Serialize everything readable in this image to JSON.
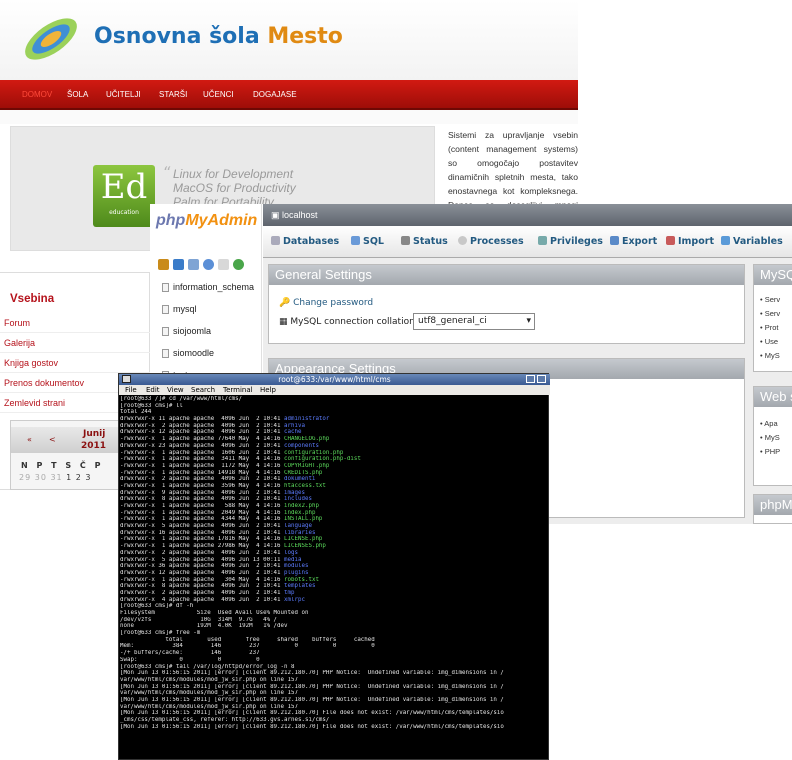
{
  "site": {
    "title_part1": "Osnovna šola",
    "title_part2": "Mesto",
    "nav": [
      "DOMOV",
      "ŠOLA",
      "UČITELJI",
      "STARŠI",
      "UČENCI",
      "DOGAJASE"
    ],
    "banner_logo_big": "Ed",
    "banner_logo_small": "education",
    "quote_mark": "“",
    "quote_lines": [
      "Linux for Development",
      "MacOS for Productivity",
      "Palm for Portability"
    ],
    "article": "Sistemi za upravljanje vsebin (content management systems) so omogočajo postavitev dinamičnih spletnih mesta, tako enostavnega kot kompleksnega. Danes so dosegljivi mnogi brezplačni sistemi, katerih cilji s",
    "sidebar_heading": "Vsebina",
    "sidebar_links": [
      "Forum",
      "Galerija",
      "Knjiga gostov",
      "Prenos dokumentov",
      "Zemlevid strani"
    ],
    "calendar": {
      "month": "Junij",
      "year": "2011",
      "prev_year": "«",
      "prev_month": "<",
      "days": "N P T S Č P",
      "row1_dim": "29 30 31",
      "row1": " 1  2  3"
    }
  },
  "pma": {
    "logo_php": "php",
    "logo_myadmin": "MyAdmin",
    "databases": [
      "information_schema",
      "mysql",
      "siojoomla",
      "siomoodle",
      "test"
    ],
    "topbar": "localhost",
    "tabs": [
      "Databases",
      "SQL",
      "Status",
      "Processes",
      "Privileges",
      "Export",
      "Import",
      "Variables"
    ],
    "general_settings": "General Settings",
    "change_password": "Change password",
    "collation_label": "MySQL connection collation",
    "collation_value": "utf8_general_ci",
    "appearance_settings": "Appearance Settings",
    "mysql_panel_title": "MySQ",
    "mysql_items": [
      "Serv",
      "Serv",
      "Prot",
      "Use",
      "MyS"
    ],
    "web_panel_title": "Web s",
    "web_items": [
      "Apa",
      "MyS",
      "PHP"
    ],
    "phpm_panel_title": "phpM"
  },
  "terminal": {
    "title": "root@633:/var/www/html/cms",
    "menu": [
      "File",
      "Edit",
      "View",
      "Search",
      "Terminal",
      "Help"
    ],
    "lines": [
      {
        "t": "[root@633 /]# cd /var/www/html/cms/",
        "c": ""
      },
      {
        "t": "[root@633 cms]# ll",
        "c": ""
      },
      {
        "t": "total 244",
        "c": ""
      },
      {
        "t": "drwxrwxr-x 11 apache apache  4096 Jun  2 10:41 ",
        "n": "administrator",
        "c": "c-blue"
      },
      {
        "t": "drwxrwxr-x  2 apache apache  4096 Jun  2 10:41 ",
        "n": "arhiva",
        "c": "c-blue"
      },
      {
        "t": "drwxrwxr-x 12 apache apache  4096 Jun  2 10:41 ",
        "n": "cache",
        "c": "c-blue"
      },
      {
        "t": "-rwxrwxr-x  1 apache apache 77640 May  4 14:16 ",
        "n": "CHANGELOG.php",
        "c": "c-green"
      },
      {
        "t": "drwxrwxr-x 23 apache apache  4096 Jun  2 10:41 ",
        "n": "components",
        "c": "c-blue"
      },
      {
        "t": "-rwxrwxr-x  1 apache apache  1606 Jun  2 10:41 ",
        "n": "configuration.php",
        "c": "c-green"
      },
      {
        "t": "-rwxrwxr-x  1 apache apache  3411 May  4 14:16 ",
        "n": "configuration.php-dist",
        "c": "c-green"
      },
      {
        "t": "-rwxrwxr-x  1 apache apache  1172 May  4 14:16 ",
        "n": "COPYRIGHT.php",
        "c": "c-green"
      },
      {
        "t": "-rwxrwxr-x  1 apache apache 14918 May  4 14:16 ",
        "n": "CREDITS.php",
        "c": "c-green"
      },
      {
        "t": "drwxrwxr-x  2 apache apache  4096 Jun  2 10:41 ",
        "n": "dokumenti",
        "c": "c-blue"
      },
      {
        "t": "-rwxrwxr-x  1 apache apache  3596 May  4 14:16 ",
        "n": "htaccess.txt",
        "c": "c-green"
      },
      {
        "t": "drwxrwxr-x  9 apache apache  4096 Jun  2 10:41 ",
        "n": "images",
        "c": "c-blue"
      },
      {
        "t": "drwxrwxr-x  8 apache apache  4096 Jun  2 10:41 ",
        "n": "includes",
        "c": "c-blue"
      },
      {
        "t": "-rwxrwxr-x  1 apache apache   588 May  4 14:16 ",
        "n": "index2.php",
        "c": "c-green"
      },
      {
        "t": "-rwxrwxr-x  1 apache apache  2049 May  4 14:16 ",
        "n": "index.php",
        "c": "c-green"
      },
      {
        "t": "-rwxrwxr-x  1 apache apache  4344 May  4 14:16 ",
        "n": "INSTALL.php",
        "c": "c-green"
      },
      {
        "t": "drwxrwxr-x  5 apache apache  4096 Jun  2 10:41 ",
        "n": "language",
        "c": "c-blue"
      },
      {
        "t": "drwxrwxr-x 16 apache apache  4096 Jun  2 10:41 ",
        "n": "libraries",
        "c": "c-blue"
      },
      {
        "t": "-rwxrwxr-x  1 apache apache 17816 May  4 14:16 ",
        "n": "LICENSE.php",
        "c": "c-green"
      },
      {
        "t": "-rwxrwxr-x  1 apache apache 27986 May  4 14:16 ",
        "n": "LICENSES.php",
        "c": "c-green"
      },
      {
        "t": "drwxrwxr-x  2 apache apache  4096 Jun  2 10:41 ",
        "n": "logs",
        "c": "c-blue"
      },
      {
        "t": "drwxrwxr-x  5 apache apache  4096 Jun 13 00:11 ",
        "n": "media",
        "c": "c-blue"
      },
      {
        "t": "drwxrwxr-x 36 apache apache  4096 Jun  2 10:41 ",
        "n": "modules",
        "c": "c-blue"
      },
      {
        "t": "drwxrwxr-x 12 apache apache  4096 Jun  2 10:41 ",
        "n": "plugins",
        "c": "c-blue"
      },
      {
        "t": "-rwxrwxr-x  1 apache apache   304 May  4 14:16 ",
        "n": "robots.txt",
        "c": "c-green"
      },
      {
        "t": "drwxrwxr-x  8 apache apache  4096 Jun  2 10:41 ",
        "n": "templates",
        "c": "c-blue"
      },
      {
        "t": "drwxrwxr-x  2 apache apache  4096 Jun  2 10:41 ",
        "n": "tmp",
        "c": "c-blue"
      },
      {
        "t": "drwxrwxr-x  4 apache apache  4096 Jun  2 10:41 ",
        "n": "xmlrpc",
        "c": "c-blue"
      },
      {
        "t": "[root@633 cms]# df -h",
        "c": ""
      },
      {
        "t": "Filesystem            Size  Used Avail Use% Mounted on",
        "c": ""
      },
      {
        "t": "/dev/vzfs              10G  314M  9.7G   4% /",
        "c": ""
      },
      {
        "t": "none                  192M  4.0K  192M   1% /dev",
        "c": ""
      },
      {
        "t": "[root@633 cms]# free -m",
        "c": ""
      },
      {
        "t": "             total       used       free     shared    buffers     cached",
        "c": ""
      },
      {
        "t": "Mem:           384        146        237          0          0          0",
        "c": ""
      },
      {
        "t": "-/+ buffers/cache:        146        237",
        "c": ""
      },
      {
        "t": "Swap:            0          0          0",
        "c": ""
      },
      {
        "t": "[root@633 cms]# tail /var/log/httpd/error_log -n 8",
        "c": ""
      },
      {
        "t": "[Mon Jun 13 01:56:15 2011] [error] [client 89.212.180.70] PHP Notice:  Undefined variable: img_dimensions in /",
        "c": ""
      },
      {
        "t": "var/www/html/cms/modules/mod_jw_sir.php on line 157",
        "c": ""
      },
      {
        "t": "[Mon Jun 13 01:56:15 2011] [error] [client 89.212.180.70] PHP Notice:  Undefined variable: img_dimensions in /",
        "c": ""
      },
      {
        "t": "var/www/html/cms/modules/mod_jw_sir.php on line 157",
        "c": ""
      },
      {
        "t": "[Mon Jun 13 01:56:15 2011] [error] [client 89.212.180.70] PHP Notice:  Undefined variable: img_dimensions in /",
        "c": ""
      },
      {
        "t": "var/www/html/cms/modules/mod_jw_sir.php on line 157",
        "c": ""
      },
      {
        "t": "[Mon Jun 13 01:56:15 2011] [error] [client 89.212.180.70] File does not exist: /var/www/html/cms/templates/sio",
        "c": ""
      },
      {
        "t": "_cms/css/template_css, referer: http://633.gvs.arnes.si/cms/",
        "c": ""
      },
      {
        "t": "[Mon Jun 13 01:56:15 2011] [error] [client 89.212.180.70] File does not exist: /var/www/html/cms/templates/sio",
        "c": ""
      }
    ]
  }
}
